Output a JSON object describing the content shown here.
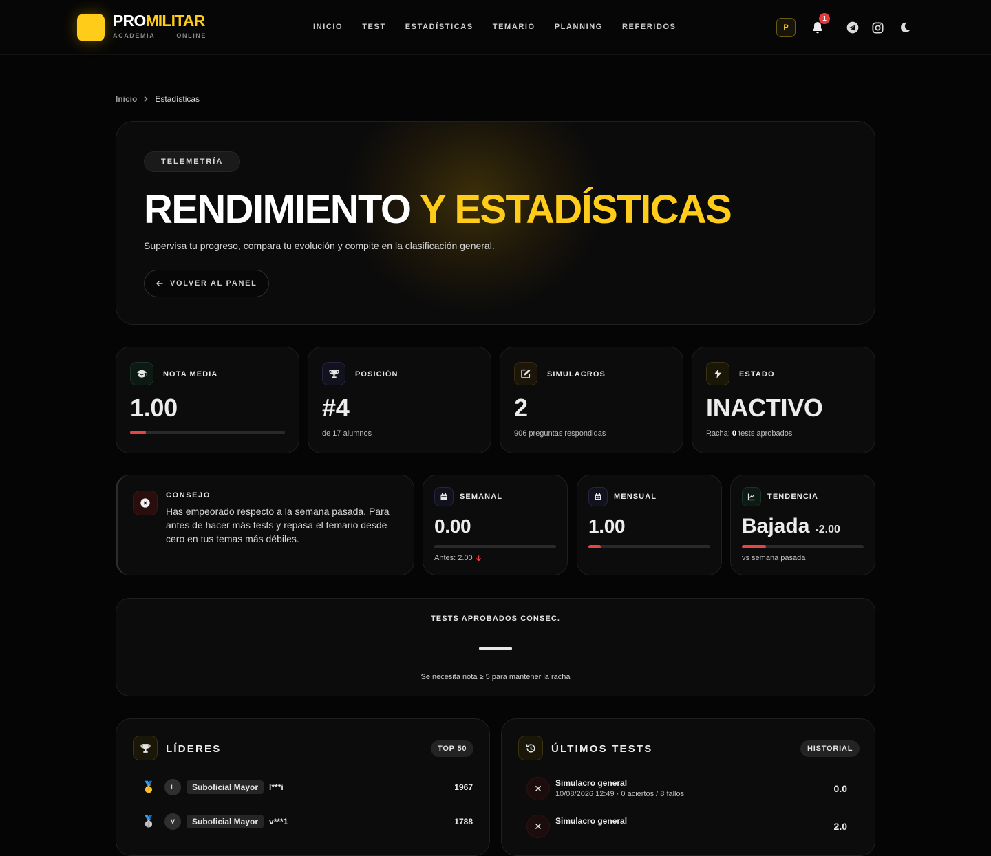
{
  "brand": {
    "name_part1": "PRO",
    "name_part2": "MILITAR",
    "sub_left": "ACADEMIA",
    "sub_right": "ONLINE",
    "accent_color": "#ffcc1a"
  },
  "nav": {
    "items": [
      "INICIO",
      "TEST",
      "ESTADÍSTICAS",
      "TEMARIO",
      "PLANNING",
      "REFERIDOS"
    ]
  },
  "header": {
    "avatar_letter": "P",
    "notification_count": "1",
    "icons": [
      "bell-icon",
      "telegram-icon",
      "instagram-icon",
      "moon-icon"
    ]
  },
  "breadcrumb": {
    "home": "Inicio",
    "current": "Estadísticas"
  },
  "hero": {
    "pill": "TELEMETRÍA",
    "title_white": "RENDIMIENTO",
    "title_yellow": "Y ESTADÍSTICAS",
    "subtitle": "Supervisa tu progreso, compara tu evolución y compite en la clasificación general.",
    "back_label": "VOLVER AL PANEL"
  },
  "stats": {
    "nota_media": {
      "label": "NOTA MEDIA",
      "value": "1.00",
      "progress": 0.1
    },
    "posicion": {
      "label": "POSICIÓN",
      "value": "#4",
      "note": "de 17 alumnos"
    },
    "simulacros": {
      "label": "SIMULACROS",
      "value": "2",
      "note": "906 preguntas respondidas"
    },
    "estado": {
      "label": "ESTADO",
      "value": "INACTIVO",
      "note_prefix": "Racha: ",
      "note_count": "0",
      "note_suffix": " tests aprobados"
    }
  },
  "advice": {
    "label": "CONSEJO",
    "text": "Has empeorado respecto a la semana pasada. Para antes de hacer más tests y repasa el temario desde cero en tus temas más débiles."
  },
  "periods": {
    "semanal": {
      "label": "SEMANAL",
      "value": "0.00",
      "progress": 0.0,
      "note": "Antes: 2.00"
    },
    "mensual": {
      "label": "MENSUAL",
      "value": "1.00",
      "progress": 0.1
    },
    "tendencia": {
      "label": "TENDENCIA",
      "value": "Bajada",
      "delta": "-2.00",
      "progress": 0.2,
      "note": "vs semana pasada"
    }
  },
  "streak": {
    "label": "TESTS APROBADOS CONSEC.",
    "value": "—",
    "note": "Se necesita nota ≥ 5 para mantener la racha"
  },
  "leaders": {
    "title": "LÍDERES",
    "tag": "TOP 50",
    "rows": [
      {
        "medal": "🥇",
        "initial": "L",
        "rank": "Suboficial Mayor",
        "name": "l***i",
        "score": "1967"
      },
      {
        "medal": "🥈",
        "initial": "V",
        "rank": "Suboficial Mayor",
        "name": "v***1",
        "score": "1788"
      }
    ]
  },
  "recent_tests": {
    "title": "ÚLTIMOS TESTS",
    "tag": "HISTORIAL",
    "rows": [
      {
        "name": "Simulacro general",
        "meta": "10/08/2026 12:49 · 0 aciertos / 8 fallos",
        "score": "0.0"
      },
      {
        "name": "Simulacro general",
        "meta": "",
        "score": "2.0"
      }
    ]
  },
  "colors": {
    "background": "#050505",
    "card": "#0c0c0c",
    "accent": "#ffcc1a",
    "danger": "#e44545"
  }
}
